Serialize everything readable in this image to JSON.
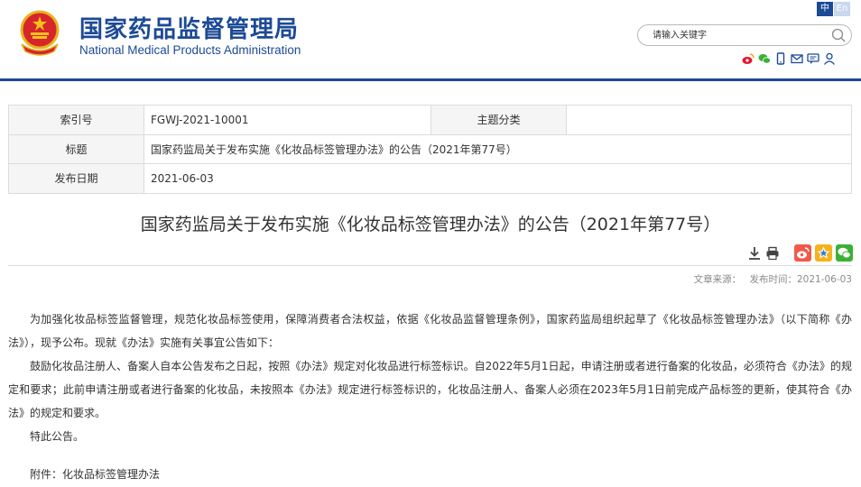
{
  "header": {
    "site_name_cn": "国家药品监督管理局",
    "site_name_en": "National Medical Products Administration",
    "lang_zh": "中",
    "lang_en": "En",
    "search_placeholder": "请输入关键字",
    "social_icons": [
      "weibo-icon",
      "wechat-icon",
      "mobile-icon",
      "mail-icon",
      "message-icon",
      "user-icon"
    ],
    "brand_color": "#1c4a96"
  },
  "meta": {
    "index_label": "索引号",
    "index_value": "FGWJ-2021-10001",
    "category_label": "主题分类",
    "category_value": "",
    "title_label": "标题",
    "title_value": "国家药监局关于发布实施《化妆品标签管理办法》的公告（2021年第77号）",
    "date_label": "发布日期",
    "date_value": "2021-06-03"
  },
  "article": {
    "title": "国家药监局关于发布实施《化妆品标签管理办法》的公告（2021年第77号）",
    "source_label": "文章来源：",
    "date_label": "发布时间：",
    "date_value": "2021-06-03",
    "paragraphs": [
      "为加强化妆品标签监督管理，规范化妆品标签使用，保障消费者合法权益，依据《化妆品监督管理条例》，国家药监局组织起草了《化妆品标签管理办法》（以下简称《办法》），现予公布。现就《办法》实施有关事宜公告如下：",
      "鼓励化妆品注册人、备案人自本公告发布之日起，按照《办法》规定对化妆品进行标签标识。自2022年5月1日起，申请注册或者进行备案的化妆品，必须符合《办法》的规定和要求；此前申请注册或者进行备案的化妆品，未按照本《办法》规定进行标签标识的，化妆品注册人、备案人必须在2023年5月1日前完成产品标签的更新，使其符合《办法》的规定和要求。",
      "特此公告。"
    ],
    "attachment": "附件：化妆品标签管理办法"
  }
}
